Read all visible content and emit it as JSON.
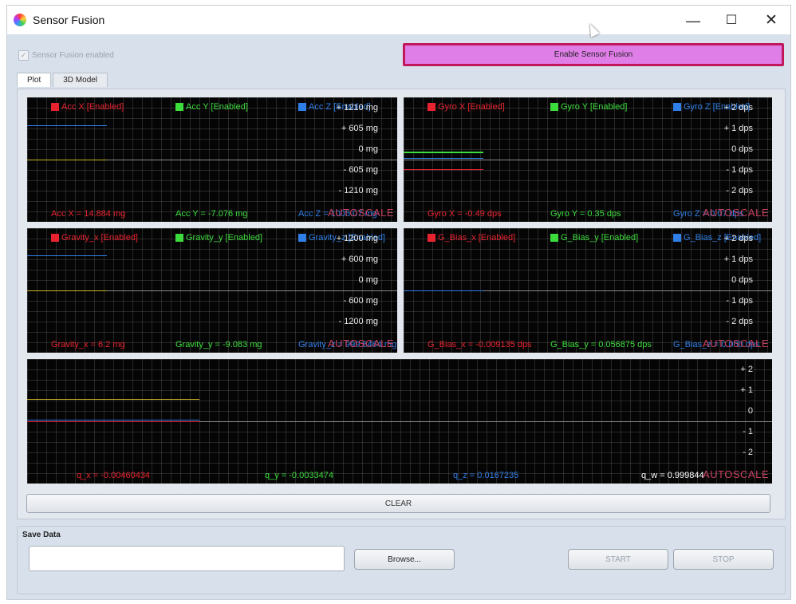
{
  "window": {
    "title": "Sensor Fusion",
    "icon": "color-wheel-icon",
    "controls": {
      "minimize": "—",
      "maximize": "☐",
      "close": "✕"
    }
  },
  "toolbar": {
    "checkbox_label": "Sensor Fusion enabled",
    "checkbox_checked": true,
    "enable_button": "Enable Sensor Fusion"
  },
  "tabs": [
    {
      "label": "Plot",
      "active": true
    },
    {
      "label": "3D Model",
      "active": false
    }
  ],
  "plots": {
    "acc": {
      "legend": [
        "Acc X [Enabled]",
        "Acc Y [Enabled]",
        "Acc Z [Enabled]"
      ],
      "axis": [
        "+ 1210 mg",
        "+ 605 mg",
        "0 mg",
        "- 605 mg",
        "- 1210 mg"
      ],
      "readouts": [
        "Acc X = 14.884 mg",
        "Acc Y = -7.076 mg",
        "Acc Z = 1006.07 mg"
      ],
      "autoscale": "AUTOSCALE"
    },
    "gyro": {
      "legend": [
        "Gyro X [Enabled]",
        "Gyro Y [Enabled]",
        "Gyro Z [Enabled]"
      ],
      "axis": [
        "+ 2 dps",
        "+ 1 dps",
        "0 dps",
        "- 1 dps",
        "- 2 dps"
      ],
      "readouts": [
        "Gyro X = -0.49 dps",
        "Gyro Y = 0.35 dps",
        "Gyro Z = 0.07 dps"
      ],
      "autoscale": "AUTOSCALE"
    },
    "gravity": {
      "legend": [
        "Gravity_x [Enabled]",
        "Gravity_y [Enabled]",
        "Gravity_z [Enabled]"
      ],
      "axis": [
        "+ 1200 mg",
        "+ 600 mg",
        "0 mg",
        "- 600 mg",
        "- 1200 mg"
      ],
      "readouts": [
        "Gravity_x = 6.2 mg",
        "Gravity_y = -9.083 mg",
        "Gravity_z = 999.8464 mg"
      ],
      "autoscale": "AUTOSCALE"
    },
    "gbias": {
      "legend": [
        "G_Bias_x [Enabled]",
        "G_Bias_y [Enabled]",
        "G_Bias_z [Enabled]"
      ],
      "axis": [
        "+ 2 dps",
        "+ 1 dps",
        "0 dps",
        "- 1 dps",
        "- 2 dps"
      ],
      "readouts": [
        "G_Bias_x = -0.009135 dps",
        "G_Bias_y = 0.056875 dps",
        "G_Bias_z = 0.000 dps"
      ],
      "autoscale": "AUTOSCALE"
    },
    "quat": {
      "axis": [
        "+ 2",
        "+ 1",
        "0",
        "- 1",
        "- 2"
      ],
      "readouts": [
        "q_x = -0.00460434",
        "q_y = -0.0033474",
        "q_z = 0.0167235",
        "q_w = 0.999844"
      ],
      "autoscale": "AUTOSCALE"
    }
  },
  "colors": {
    "x": "#e8232f",
    "y": "#3ddc3d",
    "z": "#2f7fe8",
    "w": "#ffffff",
    "accent": "#e07ee8",
    "accent_border": "#c2185b"
  },
  "clear_button": "CLEAR",
  "save": {
    "group_label": "Save Data",
    "path_value": "",
    "browse": "Browse...",
    "start": "START",
    "stop": "STOP"
  }
}
